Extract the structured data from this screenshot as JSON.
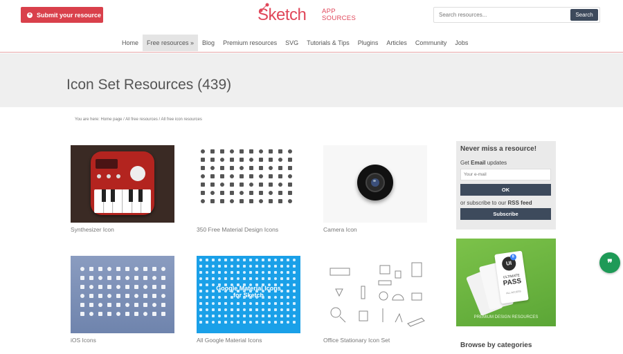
{
  "header": {
    "submit_label": "Submit your resource",
    "logo_main": "Sketch",
    "logo_sub_line1": "APP",
    "logo_sub_line2": "SOURCES",
    "search_placeholder": "Search resources...",
    "search_button": "Search"
  },
  "nav": {
    "items": [
      "Home",
      "Free resources »",
      "Blog",
      "Premium resources",
      "SVG",
      "Tutorials & Tips",
      "Plugins",
      "Articles",
      "Community",
      "Jobs"
    ],
    "active_index": 1
  },
  "page": {
    "title": "Icon Set Resources (439)",
    "breadcrumb": "You are here: Home page / All free resources / All free icon resources"
  },
  "cards": [
    {
      "caption": "Synthesizer Icon"
    },
    {
      "caption": "350 Free Material Design Icons"
    },
    {
      "caption": "Camera Icon"
    },
    {
      "caption": "iOS Icons"
    },
    {
      "caption": "All Google Material Icons",
      "overlay": "Google Material Icons\nfor Sketch"
    },
    {
      "caption": "Office Stationary Icon Set"
    }
  ],
  "sidebar": {
    "subscribe_title": "Never miss a resource!",
    "get_text_pre": "Get ",
    "get_text_bold": "Email",
    "get_text_post": " updates",
    "email_placeholder": "Your e-mail",
    "ok_label": "OK",
    "or_pre": "or subscribe to our ",
    "or_bold": "RSS feed",
    "subscribe_label": "Subscribe",
    "banner_text": "PREMIUM DESIGN RESOURCES",
    "banner_pass_line1": "ULTIMATE",
    "banner_pass_line2": "PASS",
    "banner_badge": "UI",
    "banner_badge_num": "8",
    "banner_small": "ALL-ACCESS",
    "browse_heading": "Browse by categories"
  },
  "colors": {
    "accent": "#d9404b",
    "dark_button": "#3d4a5c",
    "banner_green": "#6cb640",
    "chat_green": "#1e9a57"
  },
  "chat_icon": "quote-icon",
  "chat_glyph": "❞"
}
